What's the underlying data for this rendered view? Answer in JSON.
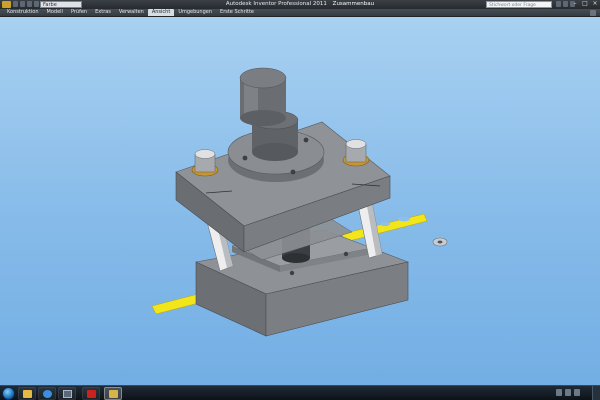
{
  "window": {
    "title": "Autodesk Inventor Professional 2011",
    "document": "Zusammenbau",
    "style_select": "Farbe",
    "help_search_placeholder": "Stichwort oder Frage eingeben"
  },
  "ribbon": {
    "tabs": [
      {
        "label": "Konstruktion",
        "active": false
      },
      {
        "label": "Modell",
        "active": false
      },
      {
        "label": "Prüfen",
        "active": false
      },
      {
        "label": "Extras",
        "active": false
      },
      {
        "label": "Verwalten",
        "active": false
      },
      {
        "label": "Ansicht",
        "active": true
      },
      {
        "label": "Umgebungen",
        "active": false
      },
      {
        "label": "Erste Schritte",
        "active": false
      }
    ]
  },
  "viewport": {
    "model": "punch-press-die-set",
    "colors": {
      "steel": "#8a8d91",
      "steel_dark": "#5f6266",
      "steel_light": "#a9acb0",
      "strip": "#f2e51c",
      "bushing": "#c8962f",
      "background_top": "#a8d0f1",
      "background_bottom": "#73aee4"
    }
  },
  "taskbar": {
    "buttons": [
      {
        "icon": "explorer-icon",
        "active": false
      },
      {
        "icon": "internet-explorer-icon",
        "active": false
      },
      {
        "icon": "windows-explorer-icon",
        "active": false
      },
      {
        "icon": "acrobat-reader-icon",
        "active": false
      },
      {
        "icon": "inventor-icon",
        "active": true
      }
    ]
  }
}
